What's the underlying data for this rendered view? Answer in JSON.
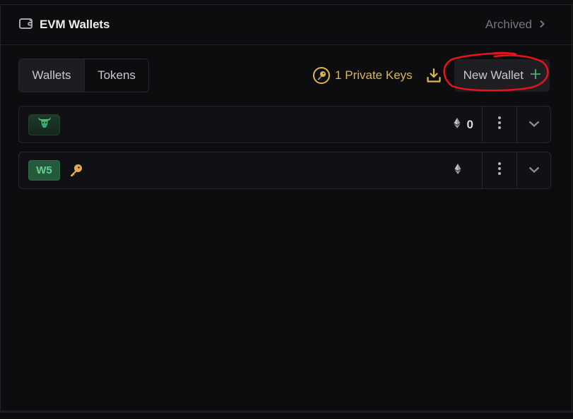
{
  "header": {
    "title": "EVM Wallets",
    "title_icon": "wallet-icon",
    "archived_label": "Archived",
    "archived_icon": "chevron-right-icon"
  },
  "toolbar": {
    "tabs": [
      {
        "label": "Wallets",
        "active": true
      },
      {
        "label": "Tokens",
        "active": false
      }
    ],
    "private_keys_label": "1 Private Keys",
    "private_keys_icon": "key-circle-icon",
    "download_icon": "download-icon",
    "new_wallet_label": "New Wallet",
    "new_wallet_icon": "plus-icon"
  },
  "wallets": [
    {
      "badge_type": "icon",
      "badge_icon": "bull-icon",
      "has_key": false,
      "balance_icon": "ethereum-icon",
      "balance": "0"
    },
    {
      "badge_type": "text",
      "badge_text": "W5",
      "has_key": true,
      "key_icon": "key-icon",
      "balance_icon": "ethereum-icon",
      "balance": ""
    }
  ],
  "colors": {
    "background": "#0d0d10",
    "accent_gold": "#dbb552",
    "accent_green": "#66d18f",
    "annotation_red": "#e8141c"
  }
}
